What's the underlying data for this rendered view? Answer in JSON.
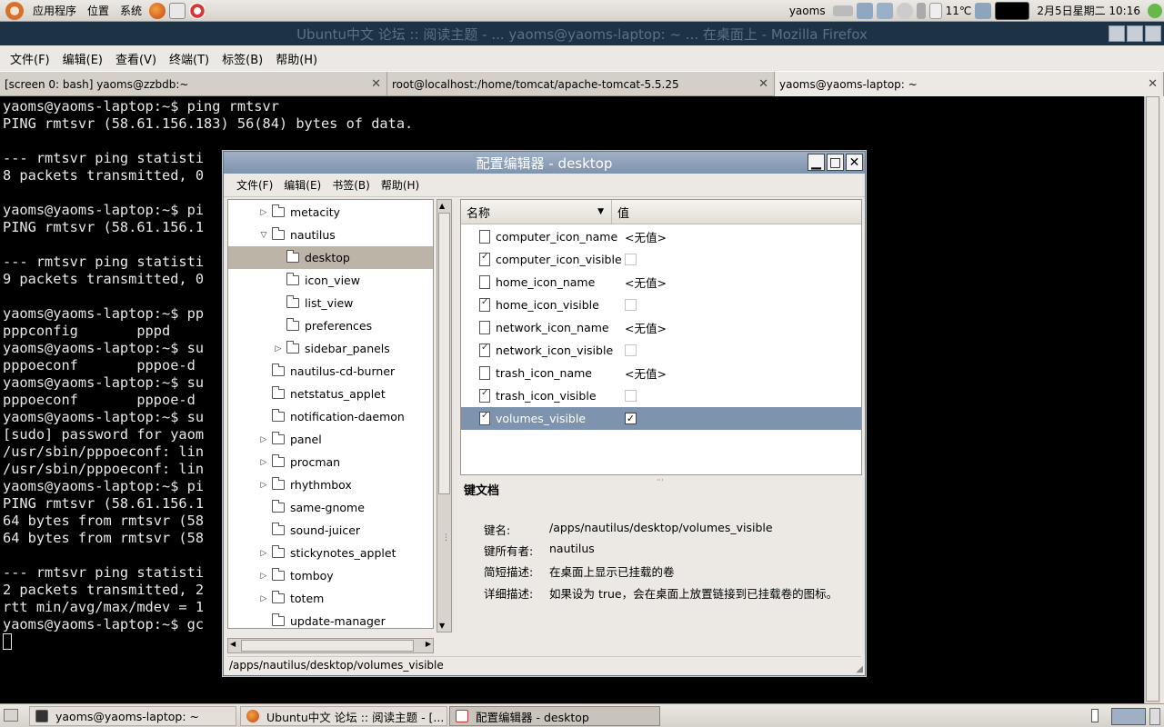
{
  "topbar": {
    "menu": [
      "应用程序",
      "位置",
      "系统"
    ],
    "user": "yaoms",
    "weather": "11℃",
    "clock": "2月5日星期二 10:16"
  },
  "background_window_title": "Ubuntu中文 论坛 :: 阅读主题 - ... yaoms@yaoms-laptop: ~ ... 在桌面上 - Mozilla Firefox",
  "terminal": {
    "menu": [
      "文件(F)",
      "编辑(E)",
      "查看(V)",
      "终端(T)",
      "标签(B)",
      "帮助(H)"
    ],
    "tabs": [
      {
        "label": "[screen 0: bash] yaoms@zzbdb:~"
      },
      {
        "label": "root@localhost:/home/tomcat/apache-tomcat-5.5.25"
      },
      {
        "label": "yaoms@yaoms-laptop: ~"
      }
    ],
    "lines": [
      "yaoms@yaoms-laptop:~$ ping rmtsvr",
      "PING rmtsvr (58.61.156.183) 56(84) bytes of data.",
      "",
      "--- rmtsvr ping statisti",
      "8 packets transmitted, 0",
      "",
      "yaoms@yaoms-laptop:~$ pi",
      "PING rmtsvr (58.61.156.1",
      "",
      "--- rmtsvr ping statisti",
      "9 packets transmitted, 0",
      "",
      "yaoms@yaoms-laptop:~$ pp",
      "pppconfig       pppd",
      "yaoms@yaoms-laptop:~$ su",
      "pppoeconf       pppoe-d",
      "yaoms@yaoms-laptop:~$ su",
      "pppoeconf       pppoe-d",
      "yaoms@yaoms-laptop:~$ su",
      "[sudo] password for yaom",
      "/usr/sbin/pppoeconf: lin",
      "/usr/sbin/pppoeconf: lin",
      "yaoms@yaoms-laptop:~$ pi",
      "PING rmtsvr (58.61.156.1",
      "64 bytes from rmtsvr (58",
      "64 bytes from rmtsvr (58",
      "",
      "--- rmtsvr ping statisti",
      "2 packets transmitted, 2",
      "rtt min/avg/max/mdev = 1",
      "yaoms@yaoms-laptop:~$ gc"
    ]
  },
  "dialog": {
    "title": "配置编辑器 - desktop",
    "menu": [
      "文件(F)",
      "编辑(E)",
      "书签(B)",
      "帮助(H)"
    ],
    "tree": [
      {
        "label": "metacity",
        "indent": 0,
        "expander": "collapsed"
      },
      {
        "label": "nautilus",
        "indent": 0,
        "expander": "expanded"
      },
      {
        "label": "desktop",
        "indent": 1,
        "expander": "none",
        "selected": true
      },
      {
        "label": "icon_view",
        "indent": 1,
        "expander": "none"
      },
      {
        "label": "list_view",
        "indent": 1,
        "expander": "none"
      },
      {
        "label": "preferences",
        "indent": 1,
        "expander": "none"
      },
      {
        "label": "sidebar_panels",
        "indent": 1,
        "expander": "collapsed"
      },
      {
        "label": "nautilus-cd-burner",
        "indent": 0,
        "expander": "none"
      },
      {
        "label": "netstatus_applet",
        "indent": 0,
        "expander": "none"
      },
      {
        "label": "notification-daemon",
        "indent": 0,
        "expander": "none"
      },
      {
        "label": "panel",
        "indent": 0,
        "expander": "collapsed"
      },
      {
        "label": "procman",
        "indent": 0,
        "expander": "collapsed"
      },
      {
        "label": "rhythmbox",
        "indent": 0,
        "expander": "collapsed"
      },
      {
        "label": "same-gnome",
        "indent": 0,
        "expander": "none"
      },
      {
        "label": "sound-juicer",
        "indent": 0,
        "expander": "none"
      },
      {
        "label": "stickynotes_applet",
        "indent": 0,
        "expander": "collapsed"
      },
      {
        "label": "tomboy",
        "indent": 0,
        "expander": "collapsed"
      },
      {
        "label": "totem",
        "indent": 0,
        "expander": "collapsed"
      },
      {
        "label": "update-manager",
        "indent": 0,
        "expander": "none"
      }
    ],
    "columns": {
      "name": "名称",
      "value": "值"
    },
    "keys": [
      {
        "name": "computer_icon_name",
        "type": "string",
        "value": "<无值>"
      },
      {
        "name": "computer_icon_visible",
        "type": "bool",
        "checked": false
      },
      {
        "name": "home_icon_name",
        "type": "string",
        "value": "<无值>"
      },
      {
        "name": "home_icon_visible",
        "type": "bool",
        "checked": false
      },
      {
        "name": "network_icon_name",
        "type": "string",
        "value": "<无值>"
      },
      {
        "name": "network_icon_visible",
        "type": "bool",
        "checked": false
      },
      {
        "name": "trash_icon_name",
        "type": "string",
        "value": "<无值>"
      },
      {
        "name": "trash_icon_visible",
        "type": "bool",
        "checked": false
      },
      {
        "name": "volumes_visible",
        "type": "bool",
        "checked": true,
        "selected": true
      }
    ],
    "doc": {
      "title": "键文档",
      "rows": [
        {
          "label": "键名:",
          "value": "/apps/nautilus/desktop/volumes_visible"
        },
        {
          "label": "键所有者:",
          "value": "nautilus"
        },
        {
          "label": "简短描述:",
          "value": "在桌面上显示已挂载的卷"
        },
        {
          "label": "详细描述:",
          "value": "如果设为 true，会在桌面上放置链接到已挂载卷的图标。"
        }
      ]
    },
    "status": "/apps/nautilus/desktop/volumes_visible"
  },
  "taskbar": [
    {
      "label": "yaoms@yaoms-laptop: ~",
      "icon": "terminal-icon",
      "active": false
    },
    {
      "label": "Ubuntu中文 论坛 :: 阅读主题 - [...",
      "icon": "firefox-icon",
      "active": false
    },
    {
      "label": "配置编辑器 - desktop",
      "icon": "gconf-icon",
      "active": true
    }
  ],
  "colors": {
    "selection": "#7e93ad",
    "tree_selection": "#bcb5a7",
    "terminal_bg": "#000000"
  }
}
